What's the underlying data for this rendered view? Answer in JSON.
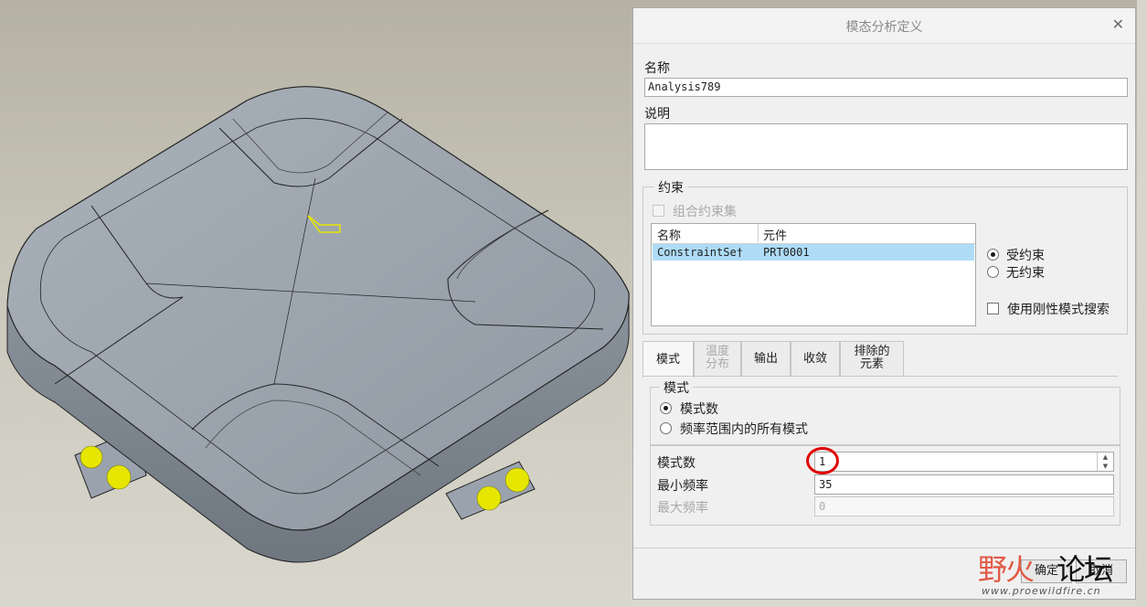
{
  "dialog": {
    "title": "模态分析定义",
    "close_glyph": "✕",
    "name_label": "名称",
    "name_value": "Analysis789",
    "desc_label": "说明",
    "desc_value": "",
    "constraints": {
      "legend": "约束",
      "combine_label": "组合约束集",
      "table": {
        "headers": [
          "名称",
          "元件"
        ],
        "rows": [
          {
            "name": "ConstraintSe†",
            "component": "PRT0001"
          }
        ]
      },
      "constrained_label": "受约束",
      "unconstrained_label": "无约束",
      "rigid_search_label": "使用刚性模式搜索"
    },
    "tabs": [
      {
        "l1": "模式",
        "l2": ""
      },
      {
        "l1": "温度",
        "l2": "分布"
      },
      {
        "l1": "输出",
        "l2": ""
      },
      {
        "l1": "收敛",
        "l2": ""
      },
      {
        "l1": "排除的",
        "l2": "元素"
      }
    ],
    "modes": {
      "legend": "模式",
      "option_count": "模式数",
      "option_range": "频率范围内的所有模式",
      "count_label": "模式数",
      "count_value": "1",
      "min_label": "最小频率",
      "min_value": "35",
      "max_label": "最大频率",
      "max_value": "0"
    },
    "ok_label": "确定",
    "cancel_label": "取消"
  },
  "watermark": {
    "cn_left": "野火",
    "cn_right": "论坛",
    "url": "www.proewildfire.cn"
  },
  "colors": {
    "model_face": "#9aa3ad",
    "model_side": "#7d8790",
    "highlight": "#e6e600",
    "selection_row": "#aedcf7",
    "annotation_circle": "#e00000"
  }
}
